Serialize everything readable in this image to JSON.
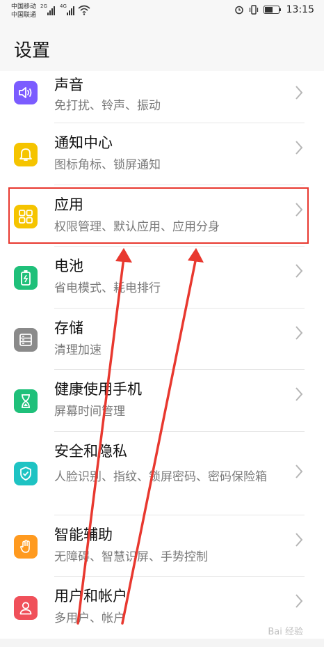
{
  "status_bar": {
    "carrier_1": "中国移动",
    "carrier_2": "中国联通",
    "network_1": "2G",
    "network_2": "4G",
    "time": "13:15"
  },
  "header": {
    "title": "设置"
  },
  "settings": [
    {
      "title": "声音",
      "subtitle": "免打扰、铃声、振动",
      "icon": "speaker-icon",
      "color": "#7b5cff"
    },
    {
      "title": "通知中心",
      "subtitle": "图标角标、锁屏通知",
      "icon": "bell-icon",
      "color": "#f5c400"
    },
    {
      "title": "应用",
      "subtitle": "权限管理、默认应用、应用分身",
      "icon": "apps-grid-icon",
      "color": "#f5c400"
    },
    {
      "title": "电池",
      "subtitle": "省电模式、耗电排行",
      "icon": "battery-icon",
      "color": "#1fc07a"
    },
    {
      "title": "存储",
      "subtitle": "清理加速",
      "icon": "storage-icon",
      "color": "#8a8a8a"
    },
    {
      "title": "健康使用手机",
      "subtitle": "屏幕时间管理",
      "icon": "hourglass-icon",
      "color": "#1fc07a"
    },
    {
      "title": "安全和隐私",
      "subtitle": "人脸识别、指纹、锁屏密码、密码保险箱",
      "icon": "shield-icon",
      "color": "#1ec3c3"
    },
    {
      "title": "智能辅助",
      "subtitle": "无障碍、智慧识屏、手势控制",
      "icon": "hand-icon",
      "color": "#ff9a1f"
    },
    {
      "title": "用户和帐户",
      "subtitle": "多用户、帐户",
      "icon": "user-icon",
      "color": "#f0505a"
    }
  ],
  "annotation_color": "#e8382f",
  "watermark": "Bai 经验"
}
